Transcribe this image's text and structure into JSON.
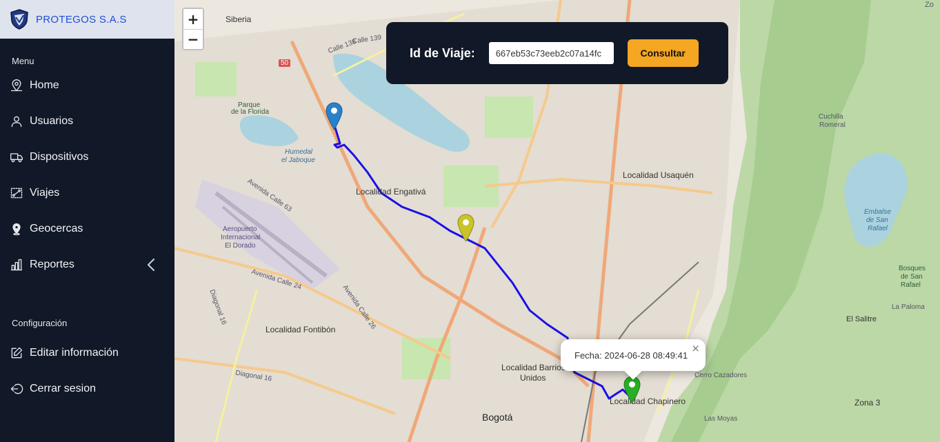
{
  "brand": {
    "name": "PROTEGOS S.A.S"
  },
  "menu": {
    "label": "Menu",
    "items": [
      {
        "label": "Home",
        "icon": "map-pin-icon"
      },
      {
        "label": "Usuarios",
        "icon": "user-icon"
      },
      {
        "label": "Dispositivos",
        "icon": "truck-icon"
      },
      {
        "label": "Viajes",
        "icon": "route-icon"
      },
      {
        "label": "Geocercas",
        "icon": "location-icon"
      },
      {
        "label": "Reportes",
        "icon": "bar-chart-icon"
      }
    ]
  },
  "config": {
    "label": "Configuración",
    "items": [
      {
        "label": "Editar información",
        "icon": "edit-icon"
      },
      {
        "label": "Cerrar sesion",
        "icon": "logout-icon"
      }
    ]
  },
  "query": {
    "label": "Id de Viaje:",
    "value": "667eb53c73eeb2c07a14fc",
    "button": "Consultar"
  },
  "zoom": {
    "in": "+",
    "out": "−"
  },
  "popup": {
    "text": "Fecha: 2024-06-28 08:49:41",
    "close": "×"
  },
  "map": {
    "labels": {
      "siberia": "Siberia",
      "engativa": "Localidad Engativá",
      "usaquen": "Localidad Usaquén",
      "fontibon": "Localidad Fontibón",
      "barrios": "Localidad Barrios",
      "unidos": "Unidos",
      "chapinero": "Localidad Chapinero",
      "bogota": "Bogotá",
      "parque": "Parque",
      "florida": "de la Florida",
      "humedal": "Humedal",
      "jaboque": "el Jaboque",
      "aero1": "Aeropuerto",
      "aero2": "Internacional",
      "aero3": "El Dorado",
      "cuchilla1": "Cuchilla",
      "cuchilla2": "Romeral",
      "embalse1": "Embalse",
      "embalse2": "de San",
      "embalse3": "Rafael",
      "bosques1": "Bosques",
      "bosques2": "de San",
      "bosques3": "Rafael",
      "salitre": "El Salitre",
      "paloma": "La Paloma",
      "cazadores": "Cerro Cazadores",
      "zona3": "Zona 3",
      "moyas": "Las Moyas",
      "calle138": "Calle 138",
      "calle139": "Calle 139",
      "r50": "50",
      "av63": "Avenida Calle 63",
      "av24": "Avenida Calle 24",
      "av26": "Avenida Calle 26",
      "diag16a": "Diagonal 16",
      "diag16b": "Diagonal 16",
      "zo": "Zo"
    }
  },
  "colors": {
    "route": "#1a0fe6",
    "sidebar": "#111827",
    "accent": "#f5a623"
  }
}
